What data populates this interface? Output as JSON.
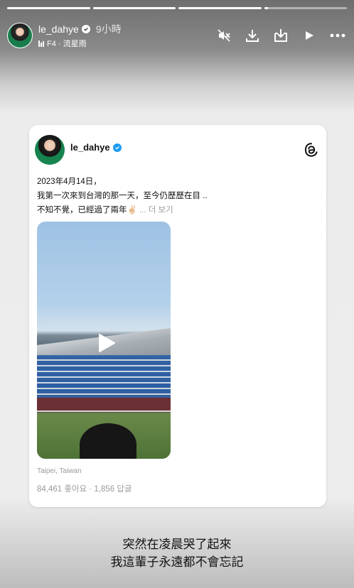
{
  "story": {
    "progress": [
      1,
      1,
      1,
      0.05
    ]
  },
  "header": {
    "username": "le_dahye",
    "time": "9小時",
    "music": "F4 · 流星雨"
  },
  "post": {
    "username": "le_dahye",
    "line1": "2023年4月14日，",
    "line2": "我第一次來到台灣的那一天，至今仍歷歷在目 ..",
    "line3": "不知不覺，已經過了兩年✌🏻",
    "more": " ... 더 보기",
    "location": "Taipei, Taiwan",
    "stats": "84,461 좋아요 · 1,856 답글"
  },
  "caption": {
    "line1": "突然在凌晨哭了起來",
    "line2": "我這輩子永遠都不會忘記"
  }
}
